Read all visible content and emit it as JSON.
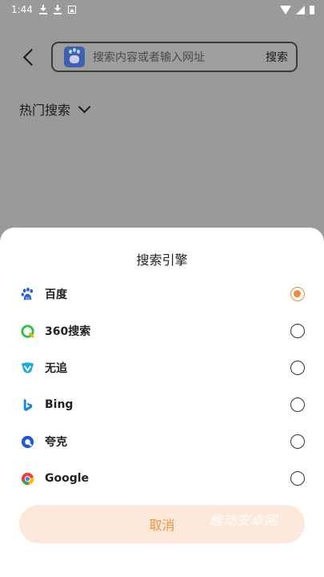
{
  "status_bar": {
    "time": "1:44"
  },
  "header": {
    "search_placeholder": "搜索内容或者输入网址",
    "search_button": "搜索"
  },
  "hot_search": {
    "label": "热门搜索"
  },
  "sheet": {
    "title": "搜索引擎",
    "engines": [
      {
        "label": "百度",
        "selected": true,
        "icon": "baidu-icon"
      },
      {
        "label": "360搜索",
        "selected": false,
        "icon": "360-search-icon"
      },
      {
        "label": "无追",
        "selected": false,
        "icon": "wuzhui-icon"
      },
      {
        "label": "Bing",
        "selected": false,
        "icon": "bing-icon"
      },
      {
        "label": "夸克",
        "selected": false,
        "icon": "quark-icon"
      },
      {
        "label": "Google",
        "selected": false,
        "icon": "google-icon"
      }
    ],
    "cancel_label": "取消",
    "watermark": "趣动安卓网"
  },
  "colors": {
    "accent": "#f08a3a",
    "cancel_bg": "#fde9db",
    "overlay": "#9a9a9a"
  }
}
